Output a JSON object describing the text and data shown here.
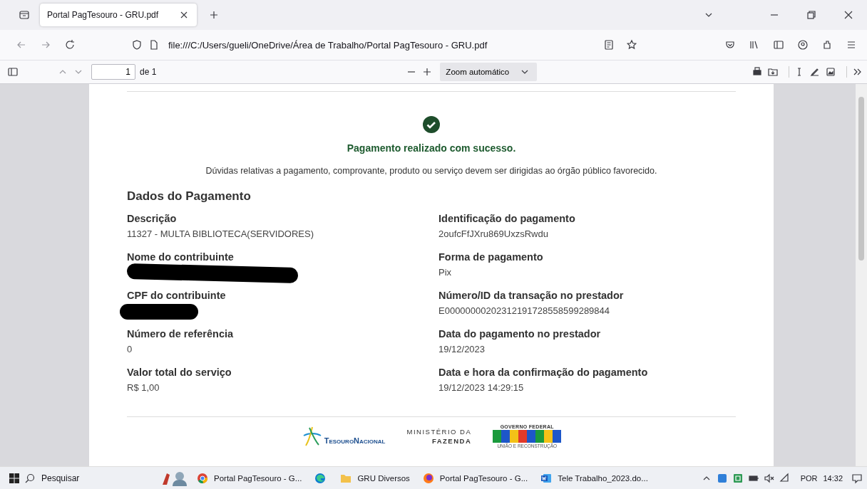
{
  "browser": {
    "tabs": [
      {
        "title": "Portal PagTesouro - GRU.pdf",
        "selected": true
      }
    ],
    "address": "file:///C:/Users/gueli/OneDrive/Área de Trabalho/Portal PagTesouro - GRU.pdf"
  },
  "pdf_toolbar": {
    "page": "1",
    "page_count": "de 1",
    "zoom": "Zoom automático"
  },
  "document": {
    "status": "Pagamento realizado com sucesso.",
    "note": "Dúvidas relativas a pagamento, comprovante, produto ou serviço devem ser dirigidas ao órgão público favorecido.",
    "section": "Dados do Pagamento",
    "fields": [
      {
        "label": "Descrição",
        "value": "11327 - MULTA BIBLIOTECA(SERVIDORES)",
        "redacted": false
      },
      {
        "label": "Identificação do pagamento",
        "value": "2oufcFfJXru869UxzsRwdu",
        "redacted": false
      },
      {
        "label": "Nome do contribuinte",
        "redacted": true
      },
      {
        "label": "Forma de pagamento",
        "value": "Pix",
        "redacted": false
      },
      {
        "label": "CPF do contribuinte",
        "redacted": true
      },
      {
        "label": "Número/ID da transação no prestador",
        "value": "E00000000202312191728558599289844",
        "redacted": false
      },
      {
        "label": "Número de referência",
        "value": "0",
        "redacted": false
      },
      {
        "label": "Data do pagamento no prestador",
        "value": "19/12/2023",
        "redacted": false
      },
      {
        "label": "Valor total do serviço",
        "value": "R$ 1,00",
        "redacted": false
      },
      {
        "label": "Data e hora da confirmação do pagamento",
        "value": "19/12/2023 14:29:15",
        "redacted": false
      }
    ],
    "footer": {
      "tesouro_a": "T",
      "tesouro_b": "ESOURO",
      "tesouro_c": "N",
      "tesouro_d": "ACIONAL",
      "ministry_line1": "MINISTÉRIO DA",
      "ministry_line2": "FAZENDA",
      "gov_top": "GOVERNO FEDERAL",
      "gov_bottom": "UNIÃO E RECONSTRUÇÃO"
    }
  },
  "taskbar": {
    "search": "Pesquisar",
    "apps": [
      {
        "kind": "chrome",
        "label": "Portal PagTesouro - G..."
      },
      {
        "kind": "edge"
      },
      {
        "kind": "folder",
        "label": "GRU Diversos"
      },
      {
        "kind": "firefox",
        "label": "Portal PagTesouro - G..."
      },
      {
        "kind": "word",
        "label": "Tele Trabalho_2023.do..."
      }
    ],
    "language": "POR",
    "time": "14:32"
  }
}
